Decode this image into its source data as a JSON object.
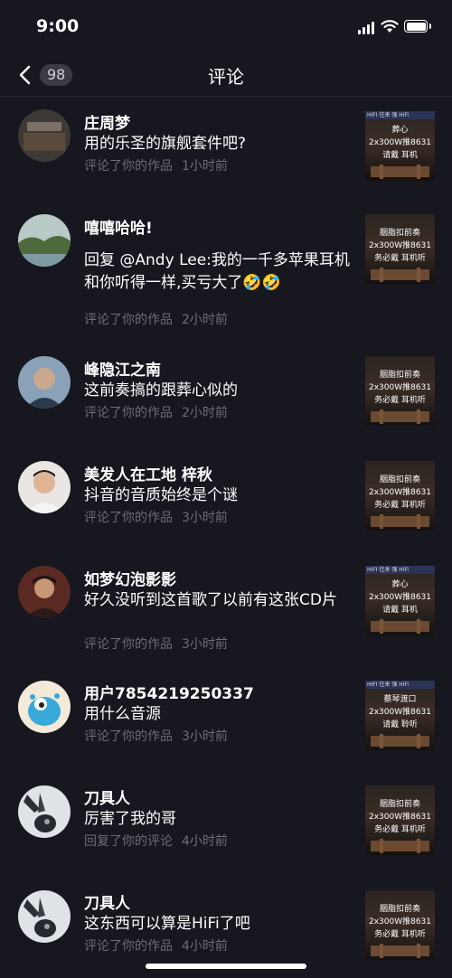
{
  "status": {
    "time": "9:00"
  },
  "nav": {
    "title": "评论",
    "badge": "98"
  },
  "comments": [
    {
      "name": "庄周梦",
      "text": "用的乐圣的旗舰套件吧?",
      "action": "评论了你的作品",
      "time": "1小时前",
      "thumb": {
        "top": "HIFI 往来 强 HiFi",
        "lines": [
          "葬心",
          "2x300W推8631",
          "请戴 耳机"
        ]
      }
    },
    {
      "name": "嘻嘻哈哈!",
      "text": "回复 @Andy Lee:我的一千多苹果耳机和你听得一样,买亏大了🤣🤣",
      "action": "评论了你的作品",
      "time": "2小时前",
      "thumb": {
        "top": "",
        "lines": [
          "胭脂扣前奏",
          "2x300W推8631",
          "务必戴 耳机听"
        ]
      }
    },
    {
      "name": "峰隐江之南",
      "text": "这前奏搞的跟葬心似的",
      "action": "评论了你的作品",
      "time": "2小时前",
      "thumb": {
        "top": "",
        "lines": [
          "胭脂扣前奏",
          "2x300W推8631",
          "务必戴 耳机听"
        ]
      }
    },
    {
      "name": "美发人在工地 梓秋",
      "text": "抖音的音质始终是个谜",
      "action": "评论了你的作品",
      "time": "3小时前",
      "thumb": {
        "top": "",
        "lines": [
          "胭脂扣前奏",
          "2x300W推8631",
          "务必戴 耳机听"
        ]
      }
    },
    {
      "name": "如梦幻泡影影",
      "text": "好久没听到这首歌了以前有这张CD片",
      "action": "评论了你的作品",
      "time": "3小时前",
      "thumb": {
        "top": "HIFI 往来 强 HiFi",
        "lines": [
          "葬心",
          "2x300W推8631",
          "请戴 耳机"
        ]
      }
    },
    {
      "name": "用户7854219250337",
      "text": "用什么音源",
      "action": "评论了你的作品",
      "time": "3小时前",
      "thumb": {
        "top": "HIFI 往来 强 HiFi",
        "lines": [
          "蔡琴渡口",
          "2x300W推8631",
          "请戴 聆听"
        ]
      }
    },
    {
      "name": "刀具人",
      "text": "厉害了我的哥",
      "action": "回复了你的评论",
      "time": "4小时前",
      "thumb": {
        "top": "",
        "lines": [
          "胭脂扣前奏",
          "2x300W推8631",
          "务必戴 耳机听"
        ]
      }
    },
    {
      "name": "刀具人",
      "text": "这东西可以算是HiFi了吧",
      "action": "评论了你的作品",
      "time": "4小时前",
      "thumb": {
        "top": "",
        "lines": [
          "胭脂扣前奏",
          "2x300W推8631",
          "务必戴 耳机听"
        ]
      }
    }
  ]
}
